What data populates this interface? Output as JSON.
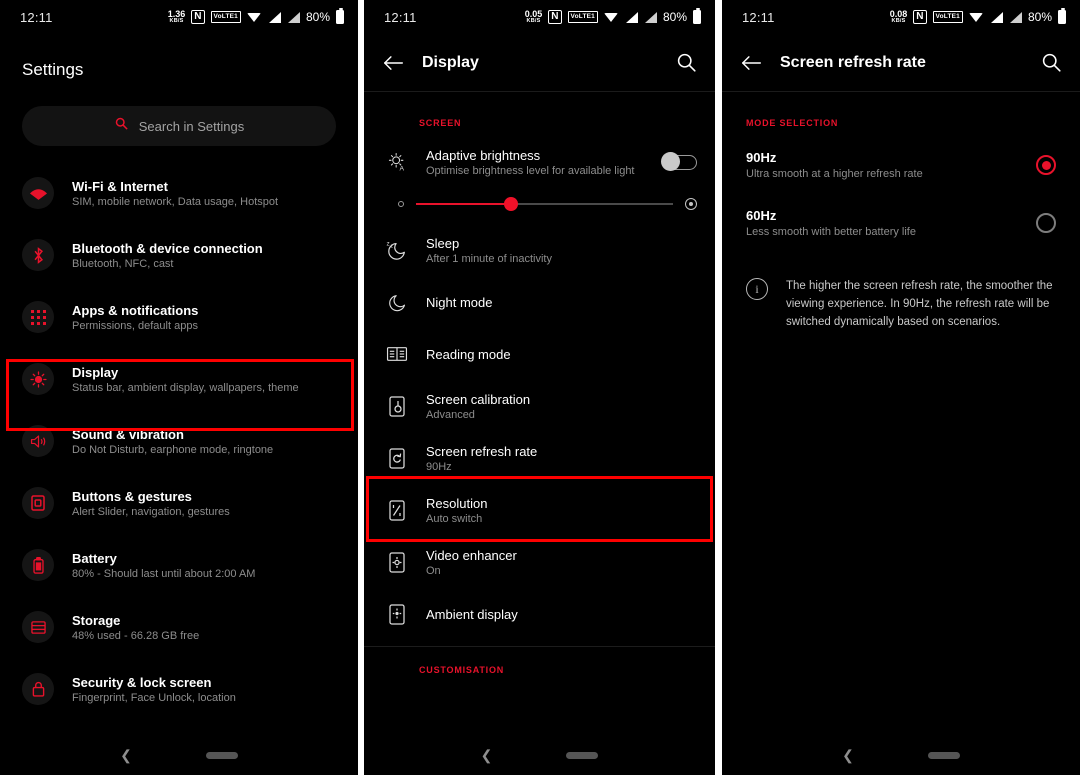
{
  "status_bar": {
    "time": "12:11",
    "data_rate_value_1": "1.36",
    "data_rate_value_2": "0.05",
    "data_rate_value_3": "0.08",
    "data_rate_unit": "KB/S",
    "nfc_label": "N",
    "volte_label": "VoLTE1",
    "battery_percent": "80%"
  },
  "panel1": {
    "title": "Settings",
    "search": {
      "placeholder": "Search in Settings"
    },
    "items": [
      {
        "icon": "wifi-icon",
        "title": "Wi-Fi & Internet",
        "sub": "SIM, mobile network, Data usage, Hotspot"
      },
      {
        "icon": "bluetooth-icon",
        "title": "Bluetooth & device connection",
        "sub": "Bluetooth, NFC, cast"
      },
      {
        "icon": "apps-icon",
        "title": "Apps & notifications",
        "sub": "Permissions, default apps"
      },
      {
        "icon": "display-icon",
        "title": "Display",
        "sub": "Status bar, ambient display, wallpapers, theme"
      },
      {
        "icon": "sound-icon",
        "title": "Sound & vibration",
        "sub": "Do Not Disturb, earphone mode, ringtone"
      },
      {
        "icon": "buttons-icon",
        "title": "Buttons & gestures",
        "sub": "Alert Slider, navigation, gestures"
      },
      {
        "icon": "battery-icon",
        "title": "Battery",
        "sub": "80% - Should last until about 2:00 AM"
      },
      {
        "icon": "storage-icon",
        "title": "Storage",
        "sub": "48% used - 66.28 GB free"
      },
      {
        "icon": "security-icon",
        "title": "Security & lock screen",
        "sub": "Fingerprint, Face Unlock, location"
      }
    ]
  },
  "panel2": {
    "appbar_title": "Display",
    "section_screen": "SCREEN",
    "section_customisation": "CUSTOMISATION",
    "adaptive_brightness": {
      "title": "Adaptive brightness",
      "sub": "Optimise brightness level for available light",
      "toggle_state": "off"
    },
    "brightness_slider": {
      "value_percent": 37
    },
    "items": [
      {
        "icon": "sleep-icon",
        "title": "Sleep",
        "sub": "After 1 minute of inactivity"
      },
      {
        "icon": "night-mode-icon",
        "title": "Night mode",
        "sub": ""
      },
      {
        "icon": "reading-mode-icon",
        "title": "Reading mode",
        "sub": ""
      },
      {
        "icon": "screen-calibration-icon",
        "title": "Screen calibration",
        "sub": "Advanced"
      },
      {
        "icon": "screen-refresh-rate-icon",
        "title": "Screen refresh rate",
        "sub": "90Hz"
      },
      {
        "icon": "resolution-icon",
        "title": "Resolution",
        "sub": "Auto switch"
      },
      {
        "icon": "video-enhancer-icon",
        "title": "Video enhancer",
        "sub": "On"
      },
      {
        "icon": "ambient-display-icon",
        "title": "Ambient display",
        "sub": ""
      }
    ]
  },
  "panel3": {
    "appbar_title": "Screen refresh rate",
    "section_header": "MODE SELECTION",
    "options": [
      {
        "title": "90Hz",
        "sub": "Ultra smooth at a higher refresh rate",
        "selected": true
      },
      {
        "title": "60Hz",
        "sub": "Less smooth with better battery life",
        "selected": false
      }
    ],
    "info_text": "The higher the screen refresh rate, the smoother the viewing experience. In 90Hz, the refresh rate will be switched dynamically based on scenarios."
  },
  "colors": {
    "accent_red": "#e8122b",
    "highlight_red": "#fe0000",
    "background": "#000000",
    "secondary_text": "#8d8d8d"
  }
}
